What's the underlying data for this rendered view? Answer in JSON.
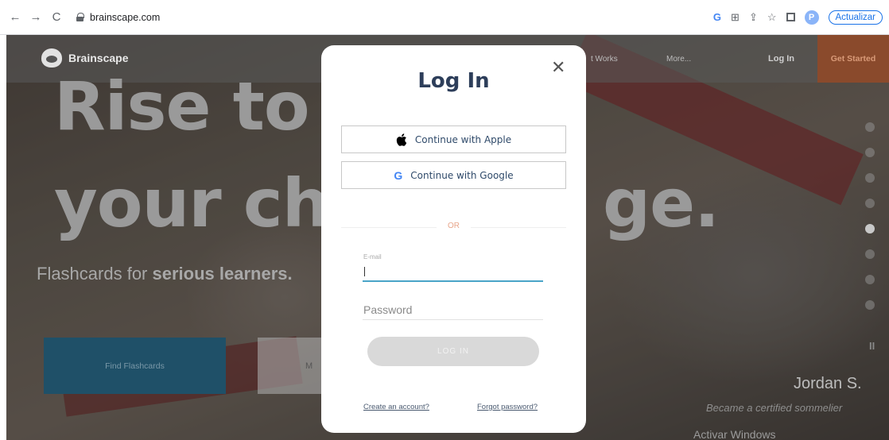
{
  "browser": {
    "url": "brainscape.com",
    "update_label": "Actualizar",
    "profile_initial": "P"
  },
  "site": {
    "logo_text": "Brainscape",
    "nav_links": [
      "t Works",
      "More..."
    ],
    "login_label": "Log In",
    "get_started_label": "Get Started",
    "hero_line1": "Rise to",
    "hero_line2": "your ch",
    "hero_line2_right": "ge.",
    "subtitle_plain": "Flashcards for ",
    "subtitle_bold": "serious learners.",
    "find_flashcards_label": "Find Flashcards",
    "m_button_label": "M",
    "pause_label": "II",
    "testimonial_name": "Jordan S.",
    "testimonial_desc": "Became a certified sommelier",
    "watermark": "Activar Windows"
  },
  "modal": {
    "title": "Log In",
    "close_label": "✕",
    "apple_label": "Continue with Apple",
    "google_label": "Continue with Google",
    "or_label": "OR",
    "email_label": "E-mail",
    "email_value": "",
    "password_placeholder": "Password",
    "login_button_label": "LOG IN",
    "create_account_label": "Create an account?",
    "forgot_password_label": "Forgot password?"
  }
}
